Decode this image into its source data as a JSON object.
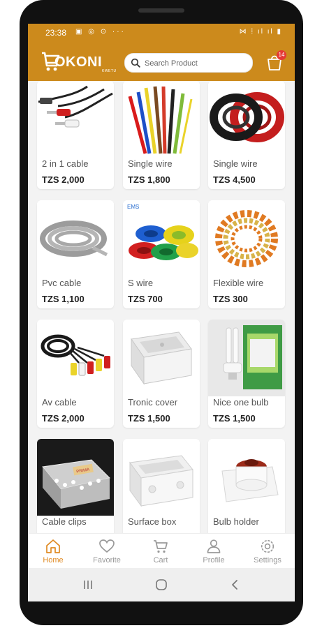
{
  "status_bar": {
    "time": "23:38",
    "left_icons": "▣ ◎ ⊙ ···",
    "right_icons": "⋈ ⁞ ıl ıl ▮"
  },
  "app": {
    "logo_text": "OKONI",
    "logo_subtext": "KWETU",
    "cart_badge": "14"
  },
  "search": {
    "placeholder": "Search Product"
  },
  "products": [
    {
      "name": "2 in 1 cable",
      "price": "TZS 2,000"
    },
    {
      "name": "Single wire",
      "price": "TZS 1,800"
    },
    {
      "name": "Single wire",
      "price": "TZS 4,500"
    },
    {
      "name": "Pvc cable",
      "price": "TZS 1,100"
    },
    {
      "name": "S wire",
      "price": "TZS 700"
    },
    {
      "name": "Flexible wire",
      "price": "TZS 300"
    },
    {
      "name": "Av cable",
      "price": "TZS 2,000"
    },
    {
      "name": "Tronic cover",
      "price": "TZS 1,500"
    },
    {
      "name": "Nice one bulb",
      "price": "TZS 1,500"
    },
    {
      "name": "Cable clips",
      "price": ""
    },
    {
      "name": "Surface box",
      "price": ""
    },
    {
      "name": "Bulb holder",
      "price": ""
    }
  ],
  "product_image_texts": {
    "s_wire_brand": "EMS",
    "cable_clips_label": "PRIMA"
  },
  "nav": [
    {
      "label": "Home",
      "icon": "home-icon",
      "active": true
    },
    {
      "label": "Favorite",
      "icon": "heart-icon",
      "active": false
    },
    {
      "label": "Cart",
      "icon": "cart-icon",
      "active": false
    },
    {
      "label": "Profile",
      "icon": "profile-icon",
      "active": false
    },
    {
      "label": "Settings",
      "icon": "settings-icon",
      "active": false
    }
  ],
  "colors": {
    "header": "#cc8a1c",
    "accent": "#e08a22",
    "badge": "#e53935"
  }
}
